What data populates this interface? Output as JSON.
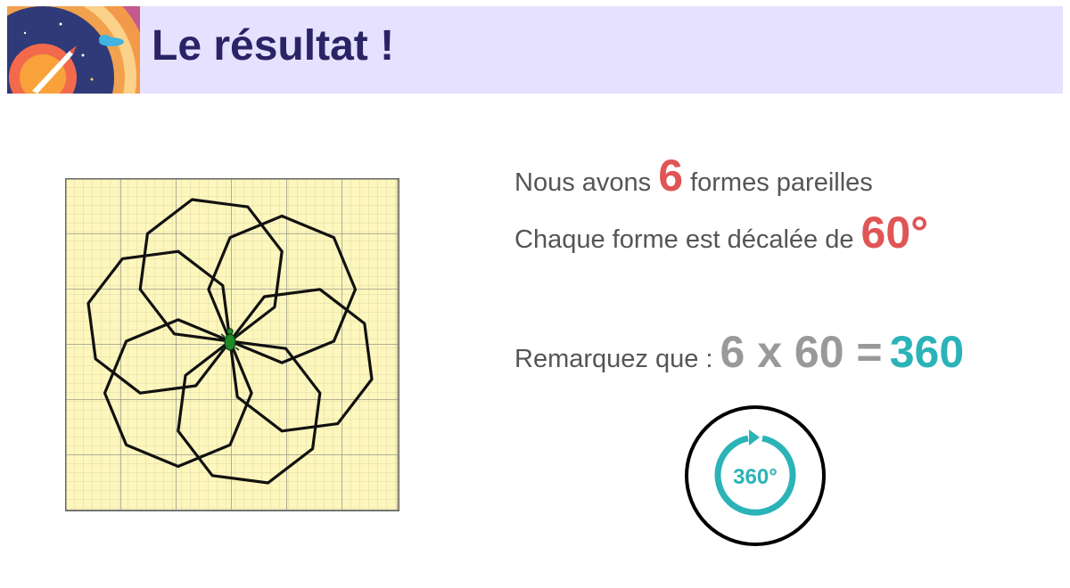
{
  "header": {
    "title": "Le résultat !"
  },
  "statements": {
    "line1_before": "Nous avons",
    "line1_number": "6",
    "line1_after": "formes pareilles",
    "line2_before": "Chaque forme est décalée de",
    "line2_angle": "60°",
    "line3_label": "Remarquez que :",
    "equation_left": "6 x 60 =",
    "equation_result": "360"
  },
  "badge": {
    "text": "360°"
  },
  "colors": {
    "header_bg": "#e6e1fe",
    "title": "#2a2466",
    "highlight_red": "#e05555",
    "equation_gray": "#999999",
    "teal": "#2bb3b8",
    "grid_bg": "#fdf7bd"
  },
  "icons": {
    "turtle": "turtle-icon",
    "rotation": "rotation-360-icon",
    "logo": "space-rocket-logo"
  }
}
